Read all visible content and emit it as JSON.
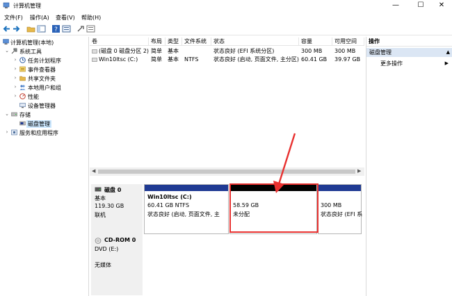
{
  "window": {
    "title": "计算机管理",
    "minimize_glyph": "—",
    "maximize_glyph": "☐",
    "close_glyph": "✕"
  },
  "menu": [
    "文件(F)",
    "操作(A)",
    "查看(V)",
    "帮助(H)"
  ],
  "tree": {
    "root": "计算机管理(本地)",
    "system_tools": "系统工具",
    "task_scheduler": "任务计划程序",
    "event_viewer": "事件查看器",
    "shared_folders": "共享文件夹",
    "local_users": "本地用户和组",
    "performance": "性能",
    "device_manager": "设备管理器",
    "storage": "存储",
    "disk_management": "磁盘管理",
    "services_apps": "服务和应用程序"
  },
  "list": {
    "columns": [
      "卷",
      "布局",
      "类型",
      "文件系统",
      "状态",
      "容量",
      "可用空间"
    ],
    "rows": [
      [
        "(磁盘 0 磁盘分区 2)",
        "简单",
        "基本",
        "",
        "状态良好 (EFI 系统分区)",
        "300 MB",
        "300 MB"
      ],
      [
        "Win10ltsc (C:)",
        "简单",
        "基本",
        "NTFS",
        "状态良好 (启动, 页面文件, 主分区)",
        "60.41 GB",
        "39.97 GB"
      ]
    ]
  },
  "disk0": {
    "name": "磁盘 0",
    "type": "基本",
    "size": "119.30 GB",
    "status": "联机",
    "partitions": {
      "c": {
        "title": "Win10ltsc  (C:)",
        "size": "60.41 GB NTFS",
        "status": "状态良好 (启动, 页面文件, 主"
      },
      "unalloc": {
        "size": "58.59 GB",
        "status": "未分配"
      },
      "efi": {
        "size": "300 MB",
        "status": "状态良好 (EFI 系"
      }
    }
  },
  "cdrom0": {
    "name": "CD-ROM 0",
    "drive": "DVD (E:)",
    "media": "无媒体"
  },
  "actions": {
    "header": "操作",
    "section": "磁盘管理",
    "more": "更多操作"
  },
  "colors": {
    "primary_partition": "#1f3a93",
    "unallocated": "#000000",
    "highlight": "#e8302f",
    "selected": "#cce8ff"
  }
}
